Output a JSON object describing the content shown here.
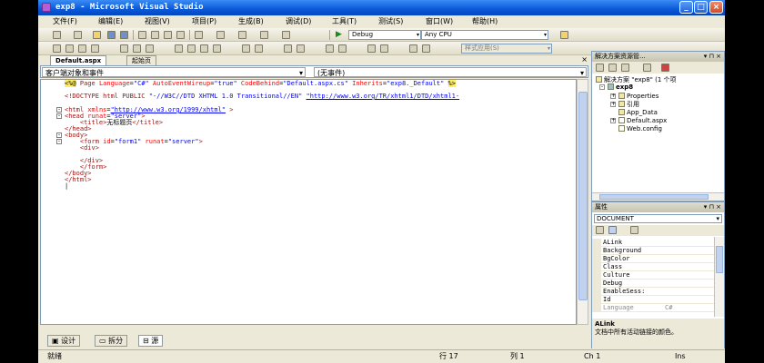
{
  "window": {
    "title": "exp8 - Microsoft Visual Studio",
    "app_icon": "visual-studio-icon",
    "buttons": {
      "minimize": "_",
      "maximize": "□",
      "close": "×"
    }
  },
  "menu": [
    "文件(F)",
    "编辑(E)",
    "视图(V)",
    "项目(P)",
    "生成(B)",
    "调试(D)",
    "工具(T)",
    "测试(S)",
    "窗口(W)",
    "帮助(H)"
  ],
  "toolbar": {
    "config_combo": "Debug",
    "platform_combo": "Any CPU",
    "style_combo": "样式应用(S)"
  },
  "document": {
    "tabs": [
      {
        "label": "Default.aspx",
        "active": true
      },
      {
        "label": "起始页",
        "active": false
      }
    ],
    "close_glyph": "×",
    "nav_left": "客户端对象和事件",
    "nav_right": "(无事件)",
    "code_lines": {
      "l1_mark": "<%@",
      "l1_page": " Page ",
      "l1_a1": "Language",
      "l1_v1": "\"C#\"",
      "l1_a2": " AutoEventWireup",
      "l1_v2": "\"true\"",
      "l1_a3": " CodeBehind",
      "l1_v3": "\"Default.aspx.cs\"",
      "l1_a4": " Inherits",
      "l1_v4": "\"exp8._Default\"",
      "l1_end": "%>",
      "l2_open": "<!DOCTYPE html PUBLIC ",
      "l2_v1": "\"-//W3C//DTD XHTML 1.0 Transitional//EN\"",
      "l2_link": "\"http://www.w3.org/TR/xhtml1/DTD/xhtml1-",
      "l3_open": "<html ",
      "l3_attr": "xmlns",
      "l3_link": "\"http://www.w3.org/1999/xhtml\"",
      "l3_close": " >",
      "l4_open": "<head ",
      "l4_attr": "runat",
      "l4_val": "\"server\"",
      "l4_close": ">",
      "l5_open": "<title>",
      "l5_text": "无标题页",
      "l5_close": "</title>",
      "l6": "</head>",
      "l7": "<body>",
      "l8_open": "<form ",
      "l8_a1": "id",
      "l8_v1": "\"form1\"",
      "l8_a2": " runat",
      "l8_v2": "\"server\"",
      "l8_close": ">",
      "l9": "<div>",
      "l10": "</div>",
      "l11": "</form>",
      "l12": "</body>",
      "l13": "</html>"
    },
    "view_tabs": [
      "设计",
      "拆分",
      "源"
    ]
  },
  "solution_explorer": {
    "title": "解决方案资源管...",
    "ctl": "▾ ⊓ ×",
    "root": "解决方案 \"exp8\" (1 个项",
    "project": "exp8",
    "items": [
      "Properties",
      "引用",
      "App_Data",
      "Default.aspx",
      "Web.config"
    ]
  },
  "properties": {
    "title": "属性",
    "ctl": "▾ ⊓ ×",
    "object": "DOCUMENT",
    "rows": [
      {
        "name": "ALink",
        "value": ""
      },
      {
        "name": "Background",
        "value": ""
      },
      {
        "name": "BgColor",
        "value": ""
      },
      {
        "name": "Class",
        "value": ""
      },
      {
        "name": "Culture",
        "value": ""
      },
      {
        "name": "Debug",
        "value": ""
      },
      {
        "name": "EnableSess:",
        "value": ""
      },
      {
        "name": "Id",
        "value": ""
      },
      {
        "name": "Language",
        "value": "C#"
      }
    ],
    "desc_name": "ALink",
    "desc_text": "文档中所有活动链接的颜色。"
  },
  "status": {
    "ready": "就绪",
    "line": "行 17",
    "col": "列 1",
    "ch": "Ch 1",
    "ins": "Ins"
  }
}
